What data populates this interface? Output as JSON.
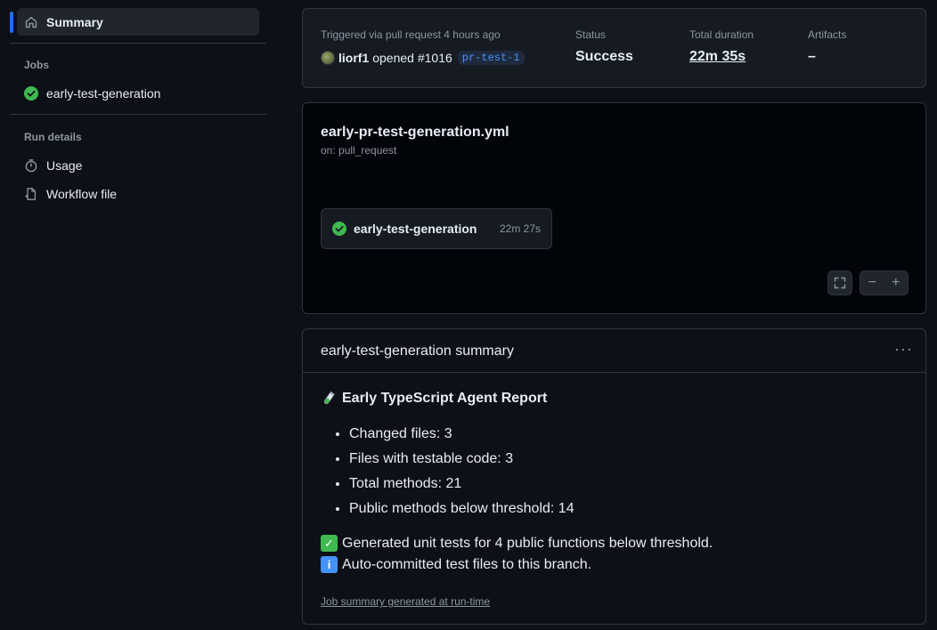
{
  "sidebar": {
    "summary_label": "Summary",
    "jobs_label": "Jobs",
    "job_item": "early-test-generation",
    "run_details_label": "Run details",
    "usage_label": "Usage",
    "workflow_file_label": "Workflow file"
  },
  "run": {
    "trigger_label": "Triggered via pull request 4 hours ago",
    "user": "liorf1",
    "action": "opened #1016",
    "branch": "pr-test-1",
    "status_label": "Status",
    "status_value": "Success",
    "duration_label": "Total duration",
    "duration_value": "22m 35s",
    "artifacts_label": "Artifacts",
    "artifacts_value": "–"
  },
  "workflow": {
    "file": "early-pr-test-generation.yml",
    "trigger": "on: pull_request",
    "job_name": "early-test-generation",
    "job_duration": "22m 27s",
    "zoom_out": "−",
    "zoom_in": "+"
  },
  "summary": {
    "header": "early-test-generation summary",
    "report_title": "Early TypeScript Agent Report",
    "stats": [
      "Changed files: 3",
      "Files with testable code: 3",
      "Total methods: 21",
      "Public methods below threshold: 14"
    ],
    "note_1": "Generated unit tests for 4 public functions below threshold.",
    "note_2": "Auto-committed test files to this branch.",
    "footer": "Job summary generated at run-time"
  },
  "colors": {
    "success": "#3fb950",
    "accent": "#1f6feb",
    "link": "#4493f8"
  }
}
